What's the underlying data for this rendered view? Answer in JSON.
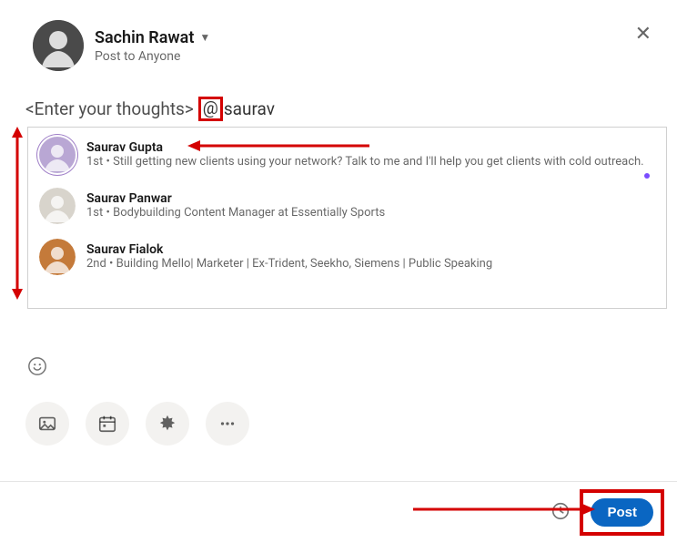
{
  "header": {
    "user_name": "Sachin Rawat",
    "post_scope": "Post to Anyone"
  },
  "compose": {
    "placeholder_prefix": "<Enter your thoughts>",
    "at_symbol": "@",
    "typed": "saurav"
  },
  "suggestions": [
    {
      "name": "Saurav Gupta",
      "subtitle": "1st • Still getting new clients using your network? Talk to me and I'll help you get clients with cold outreach.",
      "avatar_bg": "#b9a7d4",
      "ring": true
    },
    {
      "name": "Saurav Panwar",
      "subtitle": "1st • Bodybuilding Content Manager at Essentially Sports",
      "avatar_bg": "#d8d4cc",
      "ring": false
    },
    {
      "name": "Saurav Fialok",
      "subtitle": "2nd • Building Mello| Marketer | Ex-Trident, Seekho, Siemens | Public Speaking",
      "avatar_bg": "#c47a3a",
      "ring": false
    }
  ],
  "footer": {
    "post_label": "Post"
  },
  "icons": {
    "emoji": "emoji-icon",
    "image": "image-icon",
    "calendar": "calendar-icon",
    "starburst": "starburst-icon",
    "more": "more-icon",
    "schedule": "clock-icon",
    "close": "close-icon",
    "chevron_down": "chevron-down-icon"
  }
}
